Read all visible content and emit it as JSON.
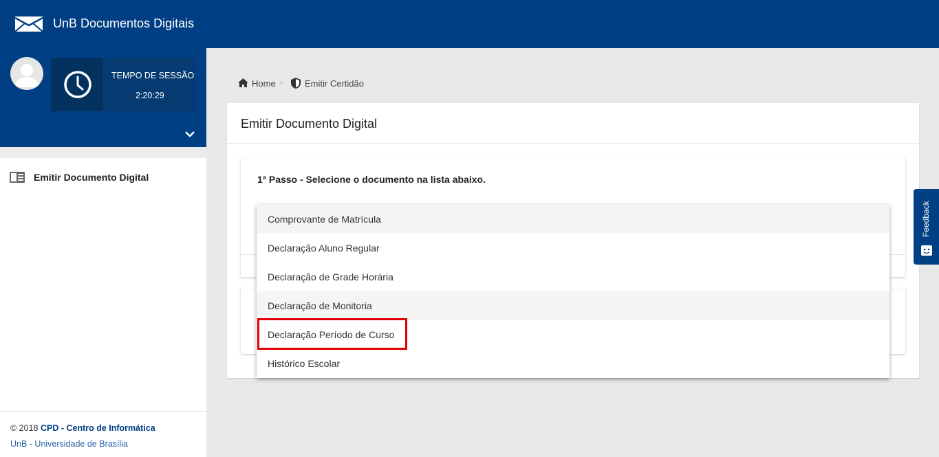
{
  "header": {
    "app_title": "UnB Documentos Digitais",
    "logo_icon": "unb-envelope-logo-icon"
  },
  "sidebar": {
    "avatar_icon": "user-avatar-icon",
    "session_label": "TEMPO DE SESSÃO",
    "session_time": "2:20:29",
    "clock_icon": "clock-icon",
    "expand_icon": "chevron-down-icon",
    "menu_items": [
      {
        "label": "Emitir Documento Digital",
        "icon": "document-list-icon"
      }
    ],
    "footer": {
      "copyright": "© 2018 ",
      "org": "CPD - Centro de Informática",
      "university": "UnB - Universidade de Brasília"
    }
  },
  "breadcrumb": {
    "home": "Home",
    "separator": ">",
    "current": "Emitir Certidão"
  },
  "main": {
    "card_title": "Emitir Documento Digital",
    "step_title": "1ª Passo - Selecione o documento na lista abaixo."
  },
  "dropdown": {
    "options": [
      "Comprovante de Matrícula",
      "Declaração Aluno Regular",
      "Declaração de Grade Horária",
      "Declaração de Monitoria",
      "Declaração Período de Curso",
      "Histórico Escolar"
    ],
    "highlighted": "Declaração Período de Curso"
  },
  "feedback": {
    "label": "Feedback"
  },
  "colors": {
    "brand": "#003f83",
    "highlight": "#e00000",
    "link": "#2a62a6"
  }
}
